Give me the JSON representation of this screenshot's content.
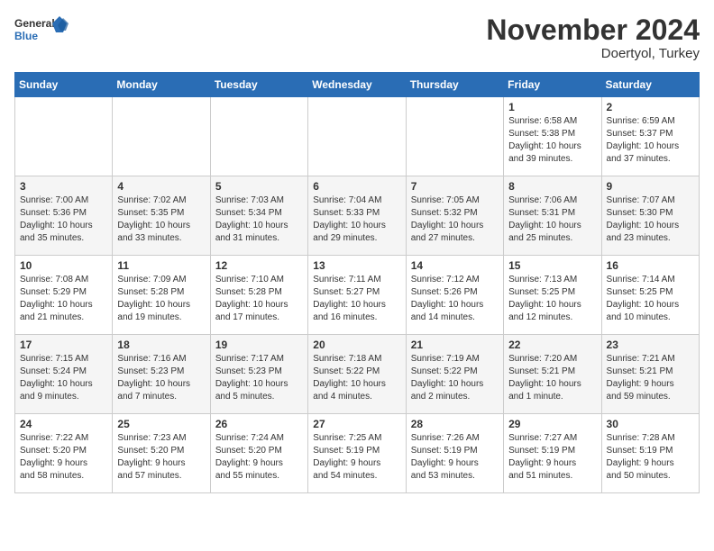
{
  "logo": {
    "text_general": "General",
    "text_blue": "Blue"
  },
  "header": {
    "month_year": "November 2024",
    "location": "Doertyol, Turkey"
  },
  "weekdays": [
    "Sunday",
    "Monday",
    "Tuesday",
    "Wednesday",
    "Thursday",
    "Friday",
    "Saturday"
  ],
  "weeks": [
    [
      {
        "day": "",
        "info": ""
      },
      {
        "day": "",
        "info": ""
      },
      {
        "day": "",
        "info": ""
      },
      {
        "day": "",
        "info": ""
      },
      {
        "day": "",
        "info": ""
      },
      {
        "day": "1",
        "info": "Sunrise: 6:58 AM\nSunset: 5:38 PM\nDaylight: 10 hours\nand 39 minutes."
      },
      {
        "day": "2",
        "info": "Sunrise: 6:59 AM\nSunset: 5:37 PM\nDaylight: 10 hours\nand 37 minutes."
      }
    ],
    [
      {
        "day": "3",
        "info": "Sunrise: 7:00 AM\nSunset: 5:36 PM\nDaylight: 10 hours\nand 35 minutes."
      },
      {
        "day": "4",
        "info": "Sunrise: 7:02 AM\nSunset: 5:35 PM\nDaylight: 10 hours\nand 33 minutes."
      },
      {
        "day": "5",
        "info": "Sunrise: 7:03 AM\nSunset: 5:34 PM\nDaylight: 10 hours\nand 31 minutes."
      },
      {
        "day": "6",
        "info": "Sunrise: 7:04 AM\nSunset: 5:33 PM\nDaylight: 10 hours\nand 29 minutes."
      },
      {
        "day": "7",
        "info": "Sunrise: 7:05 AM\nSunset: 5:32 PM\nDaylight: 10 hours\nand 27 minutes."
      },
      {
        "day": "8",
        "info": "Sunrise: 7:06 AM\nSunset: 5:31 PM\nDaylight: 10 hours\nand 25 minutes."
      },
      {
        "day": "9",
        "info": "Sunrise: 7:07 AM\nSunset: 5:30 PM\nDaylight: 10 hours\nand 23 minutes."
      }
    ],
    [
      {
        "day": "10",
        "info": "Sunrise: 7:08 AM\nSunset: 5:29 PM\nDaylight: 10 hours\nand 21 minutes."
      },
      {
        "day": "11",
        "info": "Sunrise: 7:09 AM\nSunset: 5:28 PM\nDaylight: 10 hours\nand 19 minutes."
      },
      {
        "day": "12",
        "info": "Sunrise: 7:10 AM\nSunset: 5:28 PM\nDaylight: 10 hours\nand 17 minutes."
      },
      {
        "day": "13",
        "info": "Sunrise: 7:11 AM\nSunset: 5:27 PM\nDaylight: 10 hours\nand 16 minutes."
      },
      {
        "day": "14",
        "info": "Sunrise: 7:12 AM\nSunset: 5:26 PM\nDaylight: 10 hours\nand 14 minutes."
      },
      {
        "day": "15",
        "info": "Sunrise: 7:13 AM\nSunset: 5:25 PM\nDaylight: 10 hours\nand 12 minutes."
      },
      {
        "day": "16",
        "info": "Sunrise: 7:14 AM\nSunset: 5:25 PM\nDaylight: 10 hours\nand 10 minutes."
      }
    ],
    [
      {
        "day": "17",
        "info": "Sunrise: 7:15 AM\nSunset: 5:24 PM\nDaylight: 10 hours\nand 9 minutes."
      },
      {
        "day": "18",
        "info": "Sunrise: 7:16 AM\nSunset: 5:23 PM\nDaylight: 10 hours\nand 7 minutes."
      },
      {
        "day": "19",
        "info": "Sunrise: 7:17 AM\nSunset: 5:23 PM\nDaylight: 10 hours\nand 5 minutes."
      },
      {
        "day": "20",
        "info": "Sunrise: 7:18 AM\nSunset: 5:22 PM\nDaylight: 10 hours\nand 4 minutes."
      },
      {
        "day": "21",
        "info": "Sunrise: 7:19 AM\nSunset: 5:22 PM\nDaylight: 10 hours\nand 2 minutes."
      },
      {
        "day": "22",
        "info": "Sunrise: 7:20 AM\nSunset: 5:21 PM\nDaylight: 10 hours\nand 1 minute."
      },
      {
        "day": "23",
        "info": "Sunrise: 7:21 AM\nSunset: 5:21 PM\nDaylight: 9 hours\nand 59 minutes."
      }
    ],
    [
      {
        "day": "24",
        "info": "Sunrise: 7:22 AM\nSunset: 5:20 PM\nDaylight: 9 hours\nand 58 minutes."
      },
      {
        "day": "25",
        "info": "Sunrise: 7:23 AM\nSunset: 5:20 PM\nDaylight: 9 hours\nand 57 minutes."
      },
      {
        "day": "26",
        "info": "Sunrise: 7:24 AM\nSunset: 5:20 PM\nDaylight: 9 hours\nand 55 minutes."
      },
      {
        "day": "27",
        "info": "Sunrise: 7:25 AM\nSunset: 5:19 PM\nDaylight: 9 hours\nand 54 minutes."
      },
      {
        "day": "28",
        "info": "Sunrise: 7:26 AM\nSunset: 5:19 PM\nDaylight: 9 hours\nand 53 minutes."
      },
      {
        "day": "29",
        "info": "Sunrise: 7:27 AM\nSunset: 5:19 PM\nDaylight: 9 hours\nand 51 minutes."
      },
      {
        "day": "30",
        "info": "Sunrise: 7:28 AM\nSunset: 5:19 PM\nDaylight: 9 hours\nand 50 minutes."
      }
    ]
  ]
}
